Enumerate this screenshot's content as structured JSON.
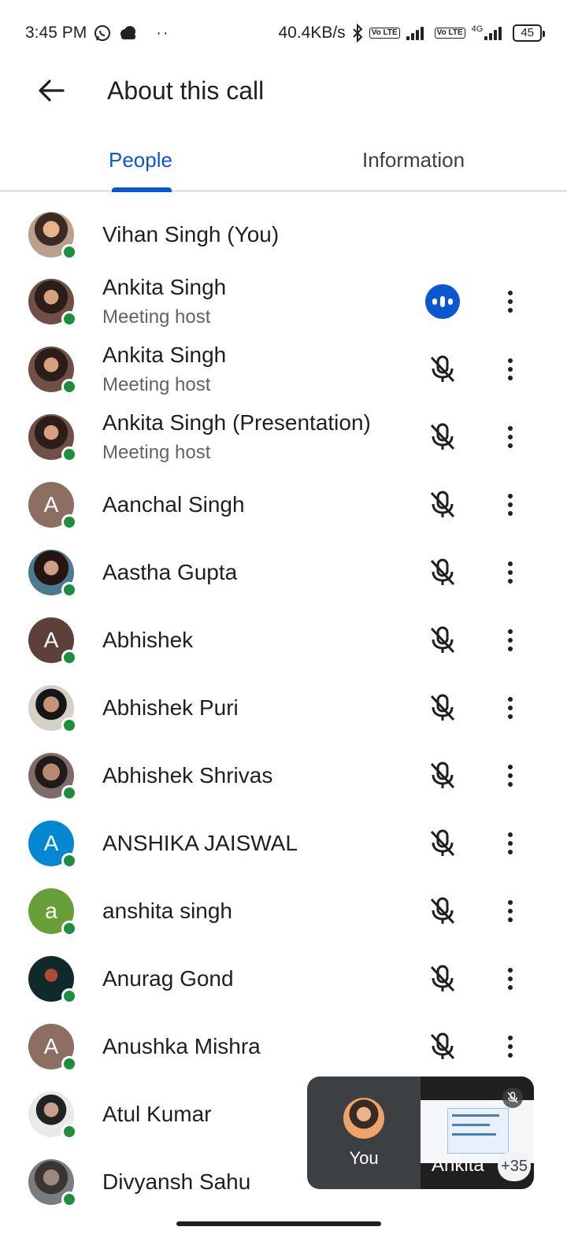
{
  "status_bar": {
    "time": "3:45 PM",
    "speed": "40.4KB/s",
    "network": "4G",
    "volte1": "Vo LTE",
    "volte2": "Vo LTE",
    "battery": "45"
  },
  "header": {
    "title": "About this call",
    "back_icon": "arrow-back-icon"
  },
  "tabs": [
    {
      "label": "People",
      "active": true
    },
    {
      "label": "Information",
      "active": false
    }
  ],
  "participants": [
    {
      "name": "Vihan Singh (You)",
      "subtitle": "",
      "avatar_letter": "",
      "avatar_type": "photo",
      "mic": "none"
    },
    {
      "name": "Ankita Singh",
      "subtitle": "Meeting host",
      "avatar_letter": "",
      "avatar_type": "photo",
      "mic": "speaking"
    },
    {
      "name": "Ankita Singh",
      "subtitle": "Meeting host",
      "avatar_letter": "",
      "avatar_type": "photo",
      "mic": "muted"
    },
    {
      "name": "Ankita Singh (Presentation)",
      "subtitle": "Meeting host",
      "avatar_letter": "",
      "avatar_type": "photo",
      "mic": "muted"
    },
    {
      "name": "Aanchal Singh",
      "subtitle": "",
      "avatar_letter": "A",
      "avatar_color": "#8d6e63",
      "mic": "muted"
    },
    {
      "name": "Aastha Gupta",
      "subtitle": "",
      "avatar_letter": "",
      "avatar_type": "photo",
      "mic": "muted"
    },
    {
      "name": "Abhishek",
      "subtitle": "",
      "avatar_letter": "A",
      "avatar_color": "#5d4037",
      "mic": "muted"
    },
    {
      "name": "Abhishek Puri",
      "subtitle": "",
      "avatar_letter": "",
      "avatar_type": "photo",
      "mic": "muted"
    },
    {
      "name": "Abhishek Shrivas",
      "subtitle": "",
      "avatar_letter": "",
      "avatar_type": "photo",
      "mic": "muted"
    },
    {
      "name": "ANSHIKA JAISWAL",
      "subtitle": "",
      "avatar_letter": "A",
      "avatar_color": "#0288d1",
      "mic": "muted"
    },
    {
      "name": "anshita singh",
      "subtitle": "",
      "avatar_letter": "a",
      "avatar_color": "#689f38",
      "mic": "muted"
    },
    {
      "name": "Anurag Gond",
      "subtitle": "",
      "avatar_letter": "",
      "avatar_type": "photo",
      "mic": "muted"
    },
    {
      "name": "Anushka Mishra",
      "subtitle": "",
      "avatar_letter": "A",
      "avatar_color": "#8d6e63",
      "mic": "muted"
    },
    {
      "name": "Atul Kumar",
      "subtitle": "",
      "avatar_letter": "",
      "avatar_type": "photo",
      "mic": "muted"
    },
    {
      "name": "Divyansh Sahu",
      "subtitle": "",
      "avatar_letter": "",
      "avatar_type": "photo",
      "mic": "muted"
    }
  ],
  "pip": {
    "you_label": "You",
    "ankita_label": "Ankita",
    "count": "+35"
  },
  "colors": {
    "accent": "#0b57d0",
    "online": "#1e8e3e",
    "pip_bg": "#3c4043"
  }
}
